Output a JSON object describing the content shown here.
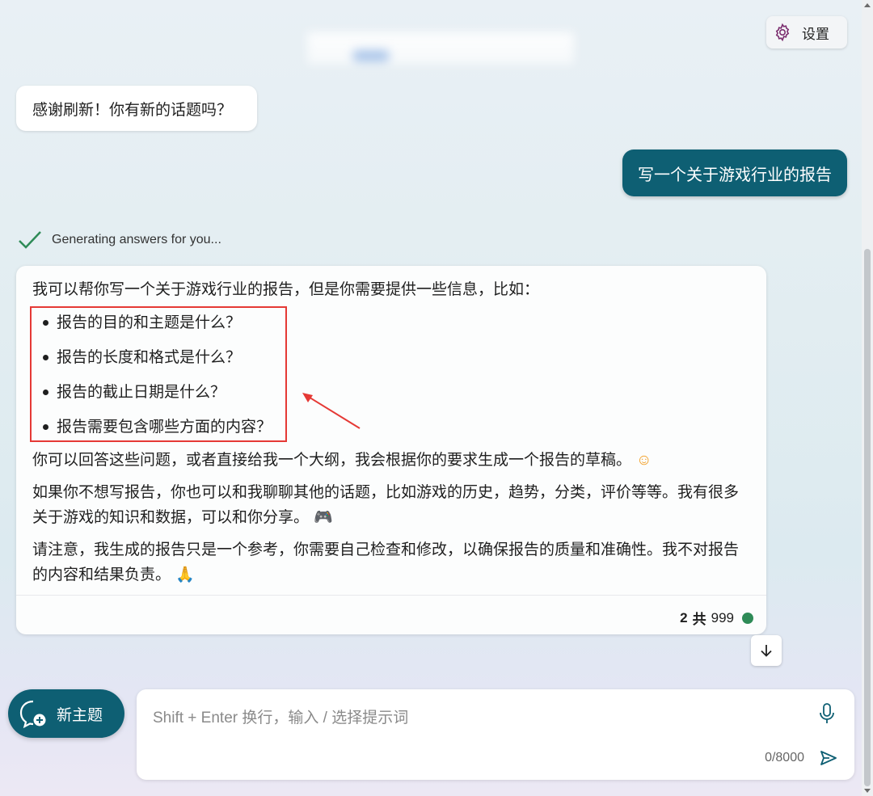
{
  "header": {
    "settings_label": "设置"
  },
  "conversation": {
    "bot_greeting": "感谢刷新！你有新的话题吗？",
    "user_message": "写一个关于游戏行业的报告",
    "status_text": "Generating answers for you...",
    "answer": {
      "intro": "我可以帮你写一个关于游戏行业的报告，但是你需要提供一些信息，比如：",
      "items": [
        "报告的目的和主题是什么？",
        "报告的长度和格式是什么？",
        "报告的截止日期是什么？",
        "报告需要包含哪些方面的内容？"
      ],
      "p2": "你可以回答这些问题，或者直接给我一个大纲，我会根据你的要求生成一个报告的草稿。",
      "p3": "如果你不想写报告，你也可以和我聊聊其他的话题，比如游戏的历史，趋势，分类，评价等等。我有很多关于游戏的知识和数据，可以和你分享。",
      "p4": "请注意，我生成的报告只是一个参考，你需要自己检查和修改，以确保报告的质量和准确性。我不对报告的内容和结果负责。",
      "counter_current": "2",
      "counter_sep": "共",
      "counter_total": "999"
    }
  },
  "composer": {
    "new_topic_label": "新主题",
    "placeholder": "Shift + Enter 换行，输入 / 选择提示词",
    "char_count": "0/8000"
  },
  "colors": {
    "accent": "#0e5f73",
    "status_green": "#2e8b57",
    "annotation_red": "#e53935"
  },
  "icons": [
    "gear-icon",
    "checkmark-icon",
    "arrow-down-icon",
    "new-chat-icon",
    "microphone-icon",
    "send-icon",
    "smile-emoji",
    "gamepad-emoji",
    "pray-emoji"
  ]
}
